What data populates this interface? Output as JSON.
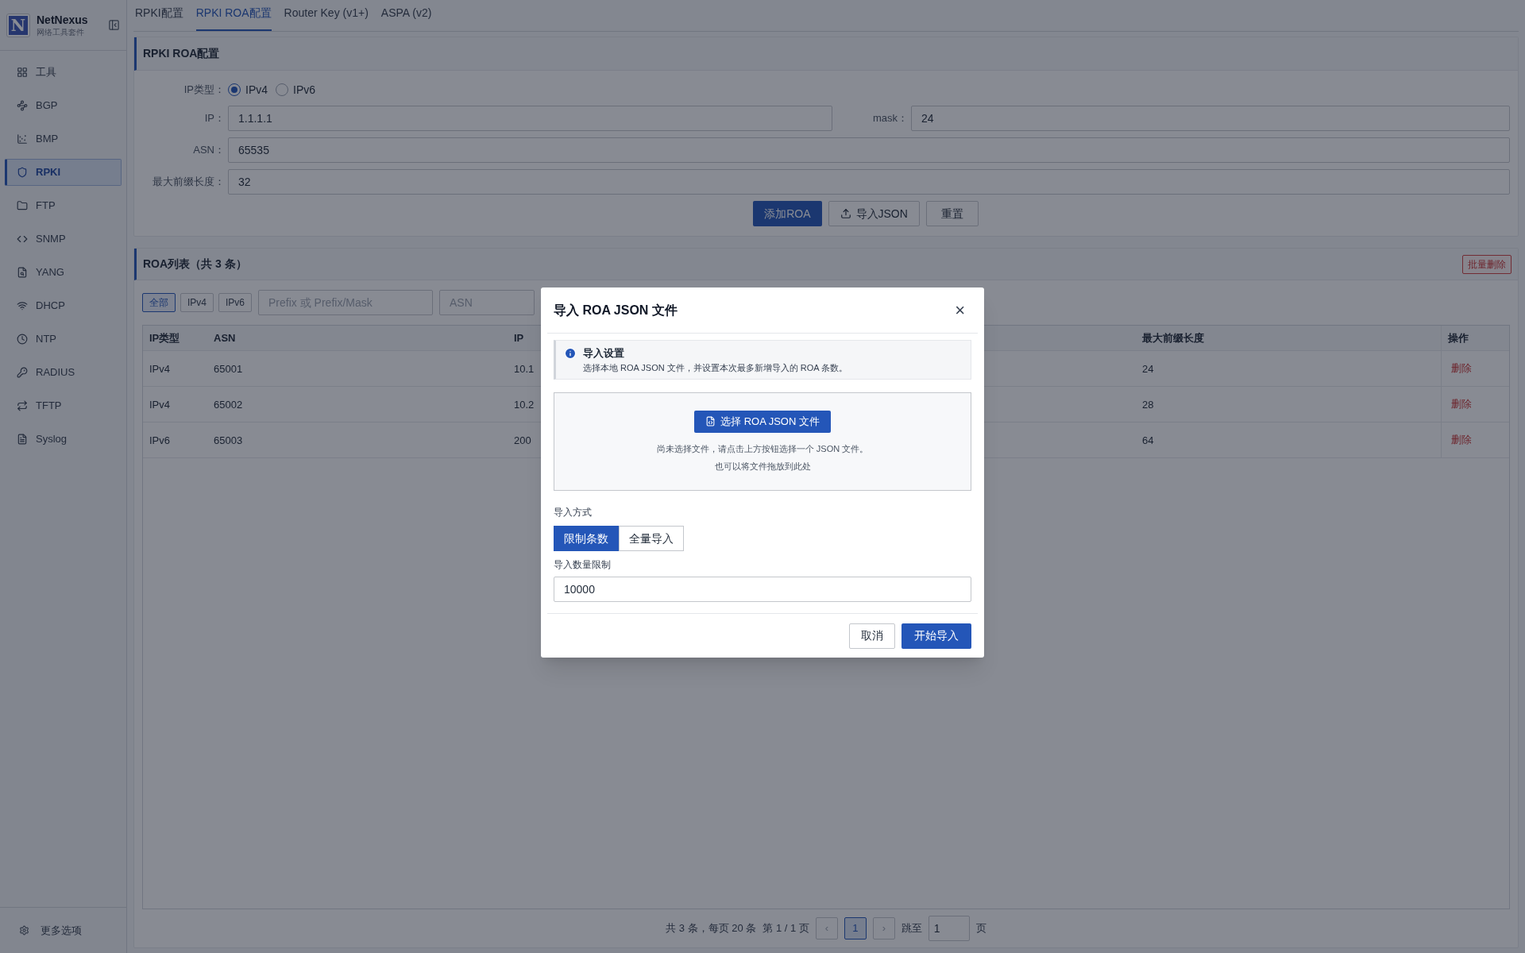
{
  "sidebar": {
    "brand": {
      "logo": "N",
      "name": "NetNexus",
      "subtitle": "网络工具套件"
    },
    "items": [
      {
        "label": "工具",
        "selected": false
      },
      {
        "label": "BGP",
        "selected": false
      },
      {
        "label": "BMP",
        "selected": false
      },
      {
        "label": "RPKI",
        "selected": true
      },
      {
        "label": "FTP",
        "selected": false
      },
      {
        "label": "SNMP",
        "selected": false
      },
      {
        "label": "YANG",
        "selected": false
      },
      {
        "label": "DHCP",
        "selected": false
      },
      {
        "label": "NTP",
        "selected": false
      },
      {
        "label": "RADIUS",
        "selected": false
      },
      {
        "label": "TFTP",
        "selected": false
      },
      {
        "label": "Syslog",
        "selected": false
      }
    ],
    "footer": {
      "label": "更多选项"
    }
  },
  "tabs": [
    {
      "label": "RPKI配置",
      "selected": false
    },
    {
      "label": "RPKI ROA配置",
      "selected": true
    },
    {
      "label": "Router Key (v1+)",
      "selected": false
    },
    {
      "label": "ASPA (v2)",
      "selected": false
    }
  ],
  "roa_form": {
    "title": "RPKI ROA配置",
    "ip_type": {
      "label": "IP类型：",
      "options": [
        {
          "label": "IPv4",
          "selected": true
        },
        {
          "label": "IPv6",
          "selected": false
        }
      ]
    },
    "ip": {
      "label": "IP：",
      "value": "1.1.1.1"
    },
    "mask": {
      "label": "mask：",
      "value": "24"
    },
    "asn": {
      "label": "ASN：",
      "value": "65535"
    },
    "max_length": {
      "label": "最大前缀长度：",
      "value": "32"
    },
    "buttons": {
      "add": "添加ROA",
      "import": "导入JSON",
      "reset": "重置"
    }
  },
  "roa_list": {
    "title": "ROA列表（共 3 条）",
    "batch_delete": "批量删除",
    "type_filters": [
      {
        "label": "全部",
        "selected": true
      },
      {
        "label": "IPv4",
        "selected": false
      },
      {
        "label": "IPv6",
        "selected": false
      }
    ],
    "prefix_placeholder": "Prefix 或 Prefix/Mask",
    "asn_placeholder": "ASN",
    "columns": [
      "IP类型",
      "ASN",
      "IP",
      "最大前缀长度",
      "操作"
    ],
    "rows": [
      [
        "IPv4",
        "65001",
        "10.1",
        "24",
        "删除"
      ],
      [
        "IPv4",
        "65002",
        "10.2",
        "28",
        "删除"
      ],
      [
        "IPv6",
        "65003",
        "200",
        "64",
        "删除"
      ]
    ],
    "pagination": {
      "summary": "共 3 条，每页 20 条",
      "page_info": "第 1 / 1 页",
      "prev": "‹",
      "pages": [
        {
          "label": "1",
          "selected": true
        }
      ],
      "next": "›",
      "jump_label": "跳至",
      "jump_value": "1",
      "jump_suffix": "页"
    }
  },
  "modal": {
    "title": "导入 ROA JSON 文件",
    "close": "×",
    "notice": {
      "title": "导入设置",
      "text": "选择本地 ROA JSON 文件，并设置本次最多新增导入的 ROA 条数。"
    },
    "upload": {
      "button": "选择 ROA JSON 文件",
      "hint": "尚未选择文件，请点击上方按钮选择一个 JSON 文件。",
      "hint2": "也可以将文件拖放到此处"
    },
    "mode": {
      "label": "导入方式",
      "options": [
        {
          "label": "限制条数",
          "selected": true
        },
        {
          "label": "全量导入",
          "selected": false
        }
      ]
    },
    "limit": {
      "label": "导入数量限制",
      "value": "10000"
    },
    "cancel": "取消",
    "confirm": "开始导入"
  }
}
